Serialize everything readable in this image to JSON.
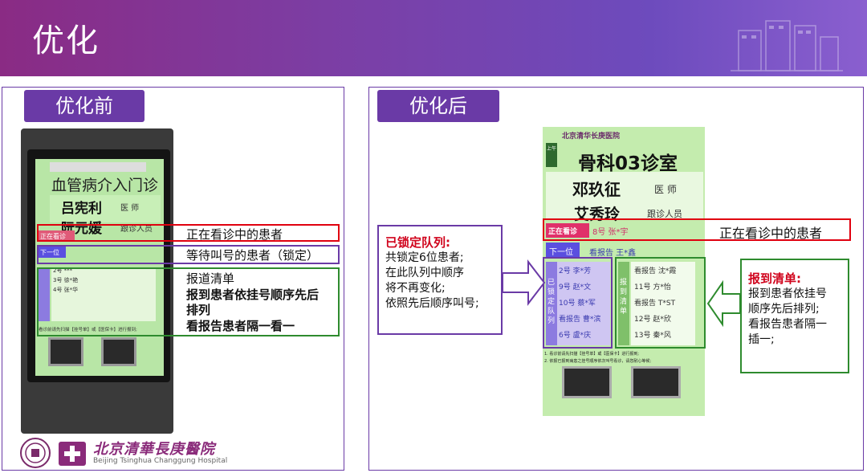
{
  "header": {
    "title": "优化"
  },
  "before": {
    "tag": "优化前",
    "screen": {
      "title": "血管病介入门诊",
      "doctor_name": "吕宪利",
      "doctor_role": "医 师",
      "assistant_name": "阮元媛",
      "assistant_role": "跟诊人员",
      "now_label": "正在看诊",
      "next_label": "下一位",
      "queue": [
        "2号 ***",
        "3号 徐*艳",
        "4号 张*华"
      ],
      "footer": "看诊前请先扫描【挂号单】或【医保卡】进行报到;"
    },
    "notes": {
      "now": "正在看诊中的患者",
      "next": "等待叫号的患者（锁定）",
      "report_title": "报道清单",
      "report_line1": "报到患者依挂号顺序先后",
      "report_line2": "排列",
      "report_line3": "看报告患者隔一看一"
    }
  },
  "after": {
    "tag": "优化后",
    "screen": {
      "hospital": "北京清华长庚医院",
      "room": "骨科03诊室",
      "doctor_name": "邓玖征",
      "doctor_role": "医 师",
      "assistant_name": "艾秀玲",
      "assistant_role": "跟诊人员",
      "corner_tag": "上午",
      "now_label": "正在看诊",
      "now_patient": "8号 张*宇",
      "next_label": "下一位",
      "next_patient": "看报告 王*鑫",
      "locked_label": "已锁定队列",
      "locked": [
        "2号 李*芳",
        "9号 赵*文",
        "10号 蔡*军",
        "看报告 曹*滨",
        "6号 盧*庆"
      ],
      "report_label": "报到清单",
      "report": [
        "看报告 沈*霞",
        "11号 方*怡",
        "看报告 T*ST",
        "12号 赵*欣",
        "13号 秦*风"
      ],
      "foot1": "1. 看诊前请先扫描【挂号单】或【医保卡】进行报到;",
      "foot2": "2. 依报已报到病患之挂号顺序依次叫号看诊，请您耐心等候;"
    },
    "now_note": "正在看诊中的患者",
    "lock_callout": {
      "title": "已锁定队列:",
      "lines": [
        "共锁定6位患者;",
        "在此队列中顺序",
        "将不再变化;",
        "依照先后顺序叫号;"
      ]
    },
    "report_callout": {
      "title": "报到清单:",
      "lines": [
        "报到患者依挂号",
        "顺序先后排列;",
        "看报告患者隔一",
        "插一;"
      ]
    }
  },
  "logo": {
    "chinese": "北京清華長庚醫院",
    "english": "Beijing Tsinghua Changgung Hospital"
  },
  "colors": {
    "purple": "#6a3aa6",
    "red": "#e0000f",
    "green": "#2e8b2e",
    "screen_green": "#b8e6a6"
  }
}
